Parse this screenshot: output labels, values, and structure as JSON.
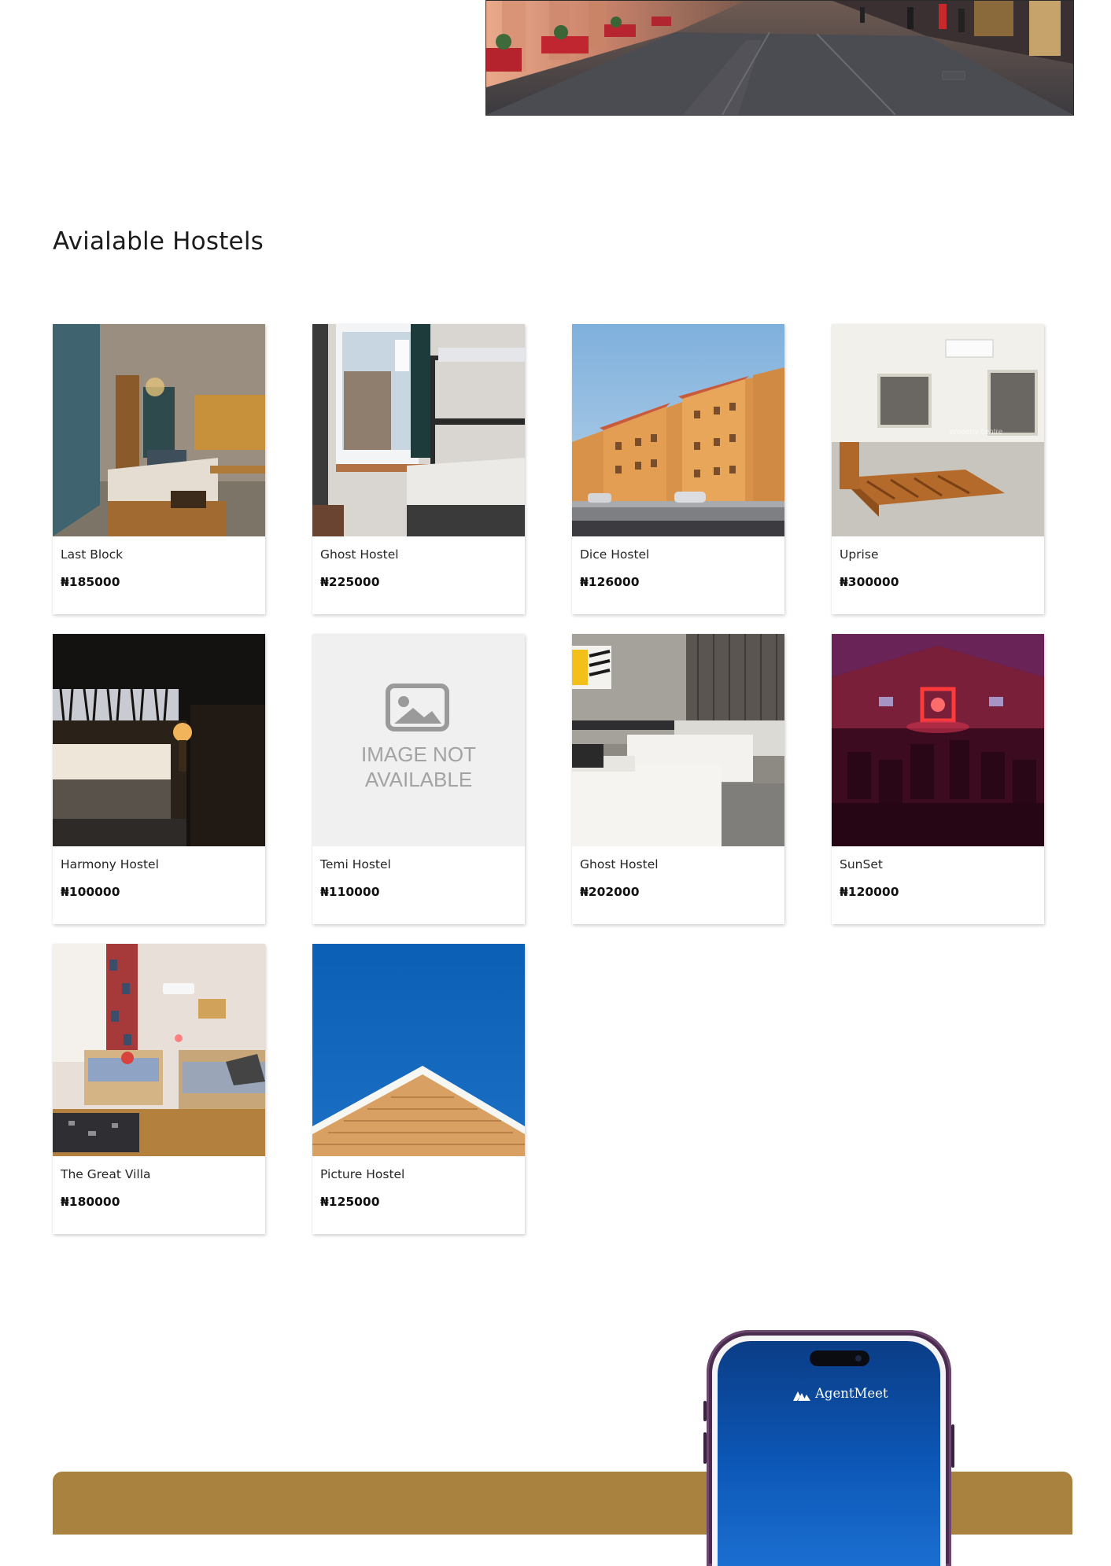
{
  "section": {
    "title": "Avialable Hostels"
  },
  "currency_symbol": "₦",
  "hostels": [
    {
      "name": "Last Block",
      "price": "₦185000",
      "image": "hostel-room-teal-wall-photo"
    },
    {
      "name": "Ghost Hostel",
      "price": "₦225000",
      "image": "bunk-bed-window-photo"
    },
    {
      "name": "Dice Hostel",
      "price": "₦126000",
      "image": "orange-apartment-blocks-photo"
    },
    {
      "name": "Uprise",
      "price": "₦300000",
      "image": "empty-room-bed-frame-photo"
    },
    {
      "name": "Harmony Hostel",
      "price": "₦100000",
      "image": "dark-hotel-room-photo"
    },
    {
      "name": "Temi Hostel",
      "price": "₦110000",
      "image": "image-placeholder",
      "placeholder_text_line1": "IMAGE NOT",
      "placeholder_text_line2": "AVAILABLE"
    },
    {
      "name": "Ghost Hostel",
      "price": "₦202000",
      "image": "twin-beds-hotel-room-photo"
    },
    {
      "name": "SunSet",
      "price": "₦120000",
      "image": "neon-lit-hall-photo"
    },
    {
      "name": "The Great Villa",
      "price": "₦180000",
      "image": "twin-wooden-beds-photo"
    },
    {
      "name": "Picture Hostel",
      "price": "₦125000",
      "image": "roof-blue-sky-photo"
    }
  ],
  "promo": {
    "app_name": "AgentMeet",
    "band_color": "#a9823f",
    "screen_color": "#0c57b7"
  },
  "colors": {
    "accent": "#a9823f",
    "text": "#1c1c1c"
  }
}
